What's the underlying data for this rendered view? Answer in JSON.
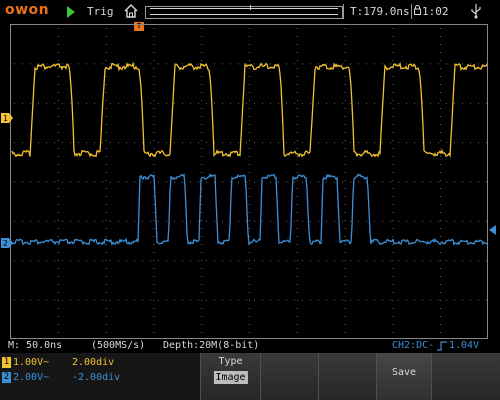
{
  "brand": "owon",
  "header": {
    "trigger_status": "Trig",
    "trigger_delay": "T:179.0ns",
    "clock": "1:02",
    "icons": [
      "run-icon",
      "home-icon",
      "lock-icon",
      "usb-icon"
    ]
  },
  "markers": {
    "trigger_position": "T",
    "ch1_marker": "1",
    "ch2_marker": "2"
  },
  "status": {
    "timebase": "M: 50.0ns",
    "sample_rate": "(500MS/s)",
    "depth": "Depth:20M(8-bit)",
    "trigger_info": "CH2:DC-",
    "trigger_level": "1.04V"
  },
  "channels": [
    {
      "id": "1",
      "scale": "1.00V~",
      "position": "2.00div",
      "color": "#f2c230"
    },
    {
      "id": "2",
      "scale": "2.00V~",
      "position": "-2.00div",
      "color": "#3c8fd6"
    }
  ],
  "menu": {
    "type_title": "Type",
    "type_value": "Image",
    "save_label": "Save"
  },
  "colors": {
    "ch1": "#f2c230",
    "ch2": "#3c8fd6",
    "brand": "#e8731a",
    "grid": "#888888"
  }
}
